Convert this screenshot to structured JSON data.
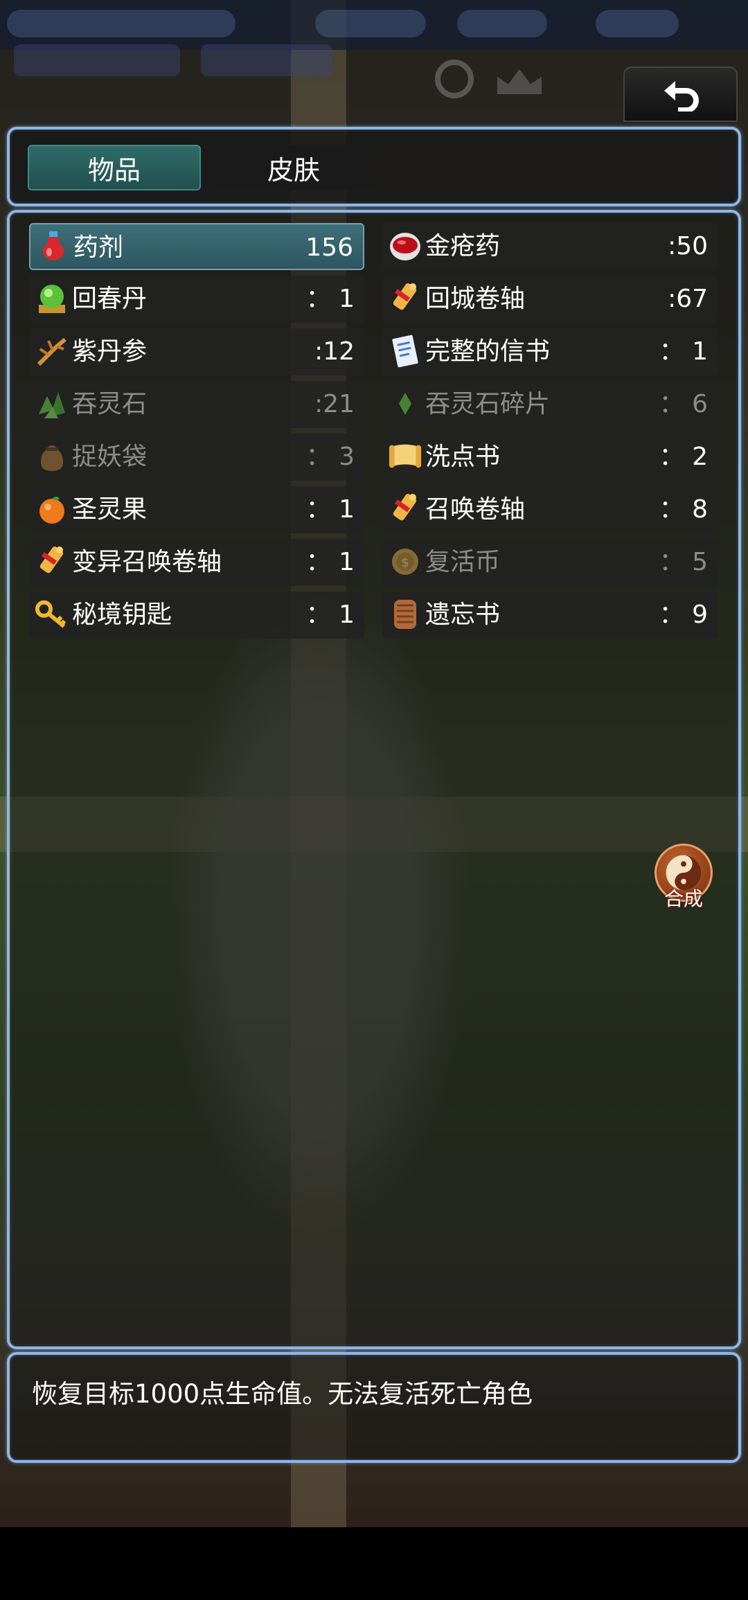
{
  "tabs": [
    {
      "label": "物品",
      "active": true
    },
    {
      "label": "皮肤",
      "active": false
    }
  ],
  "items": [
    {
      "name": "药剂",
      "qty": "156",
      "icon": "potion-icon",
      "selected": true,
      "dim": false
    },
    {
      "name": "金疮药",
      "qty": ":50",
      "icon": "red-bowl-icon",
      "selected": false,
      "dim": false
    },
    {
      "name": "回春丹",
      "qty": "： 1",
      "icon": "green-orb-icon",
      "selected": false,
      "dim": false
    },
    {
      "name": "回城卷轴",
      "qty": ":67",
      "icon": "scroll-icon",
      "selected": false,
      "dim": false
    },
    {
      "name": "紫丹参",
      "qty": ":12",
      "icon": "herb-root-icon",
      "selected": false,
      "dim": false
    },
    {
      "name": "完整的信书",
      "qty": "： 1",
      "icon": "letter-icon",
      "selected": false,
      "dim": false
    },
    {
      "name": "吞灵石",
      "qty": ":21",
      "icon": "green-crystal-icon",
      "selected": false,
      "dim": true
    },
    {
      "name": "吞灵石碎片",
      "qty": "： 6",
      "icon": "crystal-shard-icon",
      "selected": false,
      "dim": true
    },
    {
      "name": "捉妖袋",
      "qty": "： 3",
      "icon": "bag-icon",
      "selected": false,
      "dim": true
    },
    {
      "name": "洗点书",
      "qty": "： 2",
      "icon": "open-scroll-icon",
      "selected": false,
      "dim": false
    },
    {
      "name": "圣灵果",
      "qty": "： 1",
      "icon": "orange-fruit-icon",
      "selected": false,
      "dim": false
    },
    {
      "name": "召唤卷轴",
      "qty": "： 8",
      "icon": "scroll-icon",
      "selected": false,
      "dim": false
    },
    {
      "name": "变异召唤卷轴",
      "qty": "： 1",
      "icon": "scroll-icon",
      "selected": false,
      "dim": false
    },
    {
      "name": "复活币",
      "qty": "： 5",
      "icon": "coin-icon",
      "selected": false,
      "dim": true
    },
    {
      "name": "秘境钥匙",
      "qty": "： 1",
      "icon": "key-icon",
      "selected": false,
      "dim": false
    },
    {
      "name": "遗忘书",
      "qty": "： 9",
      "icon": "old-book-icon",
      "selected": false,
      "dim": false
    }
  ],
  "description": "恢复目标1000点生命值。无法复活死亡角色",
  "craft_label": "合成",
  "back_icon": "back-arrow-icon"
}
